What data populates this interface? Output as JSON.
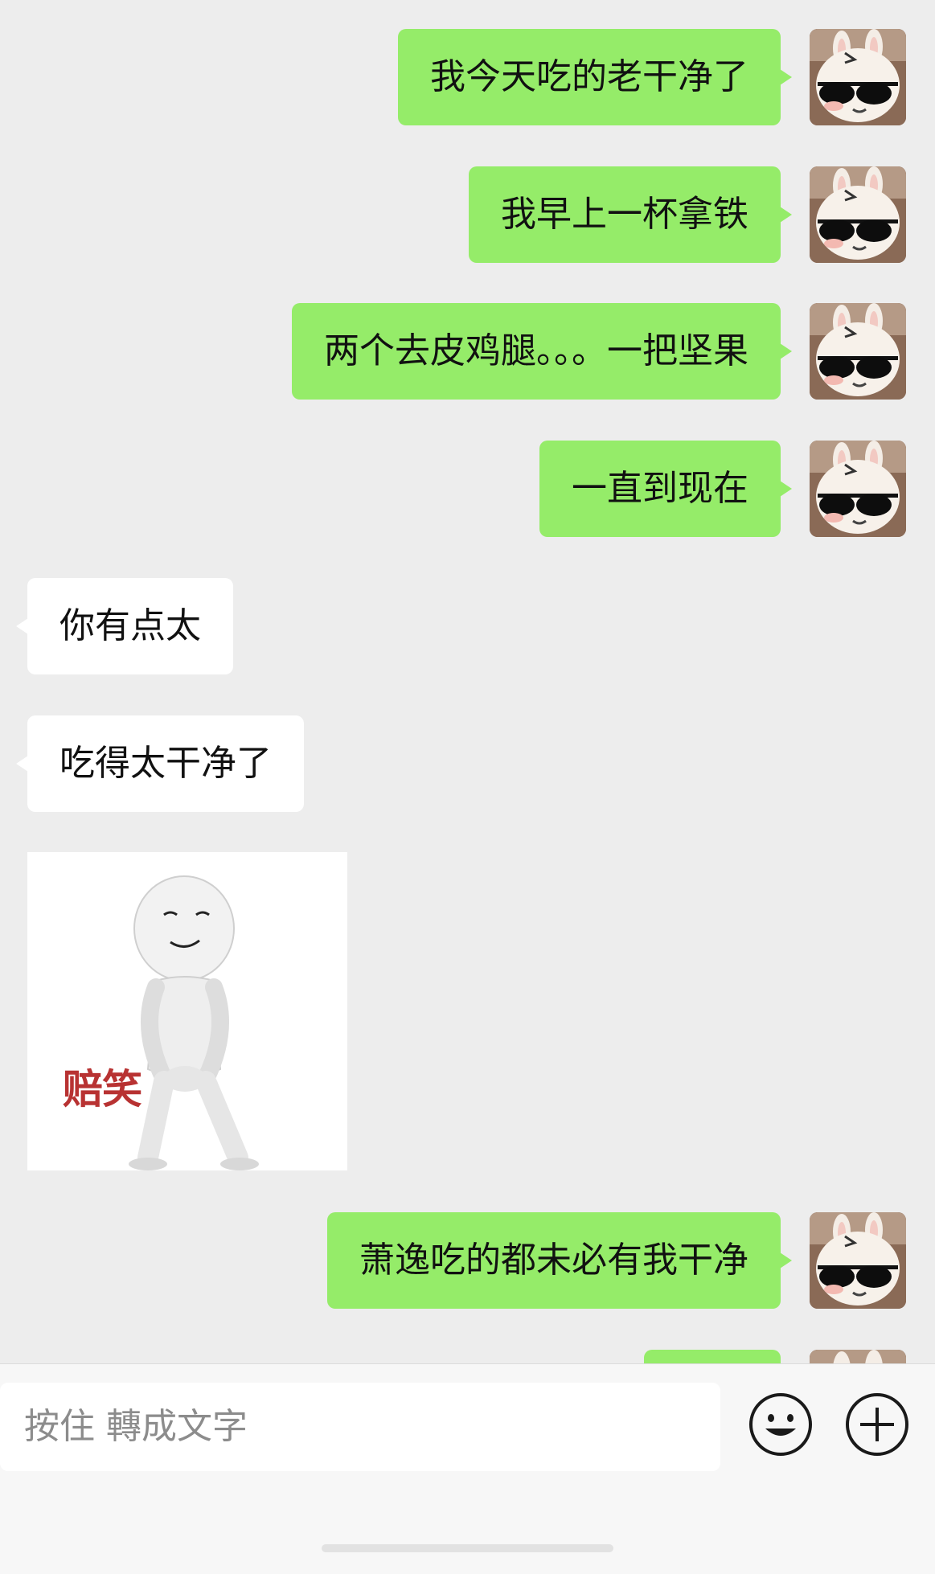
{
  "messages": [
    {
      "direction": "out",
      "text": "我今天吃的老干净了"
    },
    {
      "direction": "out",
      "text": "我早上一杯拿铁"
    },
    {
      "direction": "out",
      "text": "两个去皮鸡腿。。。一把坚果"
    },
    {
      "direction": "out",
      "text": "一直到现在"
    },
    {
      "direction": "in",
      "text": "你有点太"
    },
    {
      "direction": "in",
      "text": "吃得太干净了"
    },
    {
      "direction": "in",
      "type": "sticker",
      "caption": "赔笑"
    },
    {
      "direction": "out",
      "text": "萧逸吃的都未必有我干净"
    }
  ],
  "input_bar": {
    "voice_placeholder": "按住 轉成文字",
    "emoji_icon": "smiley-face-icon",
    "plus_icon": "plus-circle-icon"
  },
  "colors": {
    "outgoing_bubble": "#95ec69",
    "incoming_bubble": "#ffffff",
    "background": "#ededed"
  }
}
